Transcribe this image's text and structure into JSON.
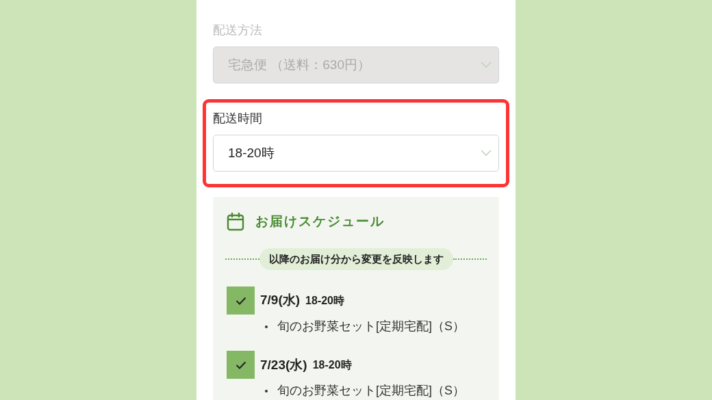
{
  "fields": [
    {
      "label": "配送方法",
      "value": "宅急便 （送料：630円）",
      "disabled": true,
      "highlighted": false
    },
    {
      "label": "配送時間",
      "value": "18-20時",
      "disabled": false,
      "highlighted": true
    }
  ],
  "schedule": {
    "title": "お届けスケジュール",
    "notice": "以降のお届け分から変更を反映します",
    "items": [
      {
        "checked": true,
        "date": "7/9(水)",
        "time": "18-20時",
        "products": [
          "旬のお野菜セット[定期宅配]（S）"
        ]
      },
      {
        "checked": true,
        "date": "7/23(水)",
        "time": "18-20時",
        "products": [
          "旬のお野菜セット[定期宅配]（S）"
        ]
      }
    ]
  }
}
